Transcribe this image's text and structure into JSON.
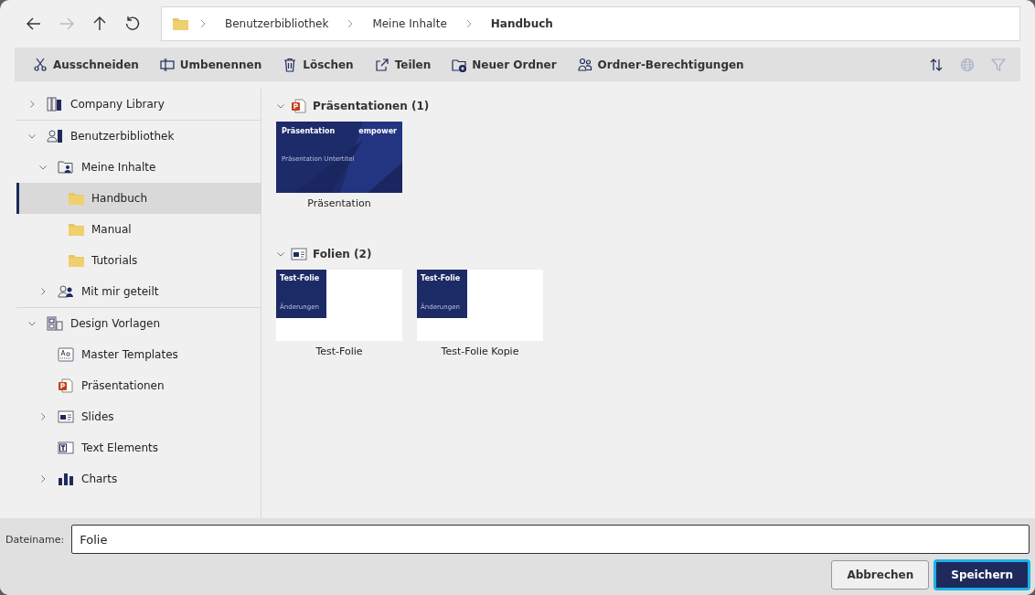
{
  "navigation": {
    "back_enabled": true,
    "forward_enabled": false
  },
  "breadcrumb": [
    {
      "label": "Benutzerbibliothek",
      "current": false
    },
    {
      "label": "Meine Inhalte",
      "current": false
    },
    {
      "label": "Handbuch",
      "current": true
    }
  ],
  "toolbar": {
    "actions": [
      {
        "kind": "cut",
        "label": "Ausschneiden"
      },
      {
        "kind": "rename",
        "label": "Umbenennen"
      },
      {
        "kind": "delete",
        "label": "Löschen"
      },
      {
        "kind": "share",
        "label": "Teilen"
      },
      {
        "kind": "new-folder",
        "label": "Neuer Ordner"
      },
      {
        "kind": "permissions",
        "label": "Ordner-Berechtigungen"
      }
    ],
    "tools": [
      {
        "kind": "sort",
        "disabled": false
      },
      {
        "kind": "globe",
        "disabled": true
      },
      {
        "kind": "filter",
        "disabled": true
      }
    ]
  },
  "sidebar": {
    "items": [
      {
        "kind": "library",
        "label": "Company Library",
        "expanded": false,
        "selected": false
      },
      {
        "kind": "user-library",
        "label": "Benutzerbibliothek",
        "expanded": true,
        "selected": false,
        "children": [
          {
            "kind": "user-folder",
            "label": "Meine Inhalte",
            "expanded": true,
            "selected": false,
            "children": [
              {
                "kind": "folder",
                "label": "Handbuch",
                "selected": true
              },
              {
                "kind": "folder",
                "label": "Manual",
                "selected": false
              },
              {
                "kind": "folder",
                "label": "Tutorials",
                "selected": false
              }
            ]
          },
          {
            "kind": "shared",
            "label": "Mit mir geteilt",
            "expanded": false,
            "selected": false
          }
        ]
      },
      {
        "kind": "templates",
        "label": "Design Vorlagen",
        "expanded": true,
        "selected": false,
        "children": [
          {
            "kind": "master",
            "label": "Master Templates",
            "selected": false
          },
          {
            "kind": "presentation",
            "label": "Präsentationen",
            "selected": false
          },
          {
            "kind": "slides",
            "label": "Slides",
            "expanded": false,
            "selected": false
          },
          {
            "kind": "text",
            "label": "Text Elements",
            "selected": false
          },
          {
            "kind": "charts",
            "label": "Charts",
            "expanded": false,
            "selected": false
          }
        ]
      }
    ]
  },
  "groups": [
    {
      "kind": "presentation",
      "title": "Präsentationen (1)",
      "expanded": true,
      "files": [
        {
          "kind": "presentation",
          "name": "Präsentation",
          "thumb_title": "Präsentation",
          "thumb_logo": "empower",
          "thumb_subtitle": "Präsentation Untertitel"
        }
      ]
    },
    {
      "kind": "slides",
      "title": "Folien (2)",
      "expanded": true,
      "files": [
        {
          "kind": "slide",
          "name": "Test-Folie",
          "thumb_title": "Test-Folie",
          "thumb_subtitle": "Änderungen"
        },
        {
          "kind": "slide",
          "name": "Test-Folie Kopie",
          "thumb_title": "Test-Folie",
          "thumb_subtitle": "Änderungen"
        }
      ]
    }
  ],
  "filename": {
    "label": "Dateiname:",
    "value": "Folie"
  },
  "buttons": [
    {
      "kind": "secondary",
      "label": "Abbrechen"
    },
    {
      "kind": "primary",
      "label": "Speichern"
    }
  ]
}
